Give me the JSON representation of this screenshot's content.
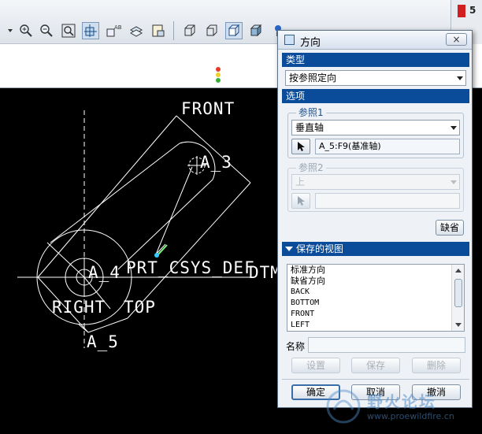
{
  "toolbar": {
    "icons": [
      "dropdown-arrow-icon",
      "zoom-in-icon",
      "zoom-out-icon",
      "refit-icon",
      "reorient-icon",
      "saved-views-icon",
      "layers-icon",
      "view-manager-icon",
      "wireframe-icon",
      "hidden-line-icon",
      "no-hidden-icon",
      "shading-icon",
      "light-icon"
    ],
    "right_badge": "5",
    "status_icon": "traffic-light-icon"
  },
  "graphics": {
    "labels": {
      "front": "FRONT",
      "a3": "A_3",
      "a4": "A_4",
      "prt_csys": "PRT_CSYS_DEF",
      "dtm": "DTM",
      "right": "RIGHT",
      "top": "TOP",
      "a5": "A_5"
    },
    "colors": {
      "background": "#000000",
      "lines": "#ffffff",
      "highlight": "#7cfc7c",
      "point": "#33ccff"
    }
  },
  "dialog": {
    "title": "方向",
    "close_label": "×",
    "type_section": "类型",
    "type_value": "按参照定向",
    "options_section": "选项",
    "ref1": {
      "label": "参照1",
      "direction_value": "垂直轴",
      "selection": "A_5:F9(基准轴)"
    },
    "ref2": {
      "label": "参照2",
      "direction_value": "上",
      "selection": ""
    },
    "default_button": "缺省",
    "saved_views_section": "保存的视图",
    "saved_views": [
      "标准方向",
      "缺省方向",
      "BACK",
      "BOTTOM",
      "FRONT",
      "LEFT"
    ],
    "name_label": "名称",
    "name_value": "",
    "set_button": "设置",
    "save_button": "保存",
    "delete_button": "删除",
    "ok_button": "确定",
    "cancel_button": "取消",
    "revert_button": "撤消"
  },
  "watermark": {
    "text": "野火论坛",
    "url": "www.proewildfire.cn"
  }
}
